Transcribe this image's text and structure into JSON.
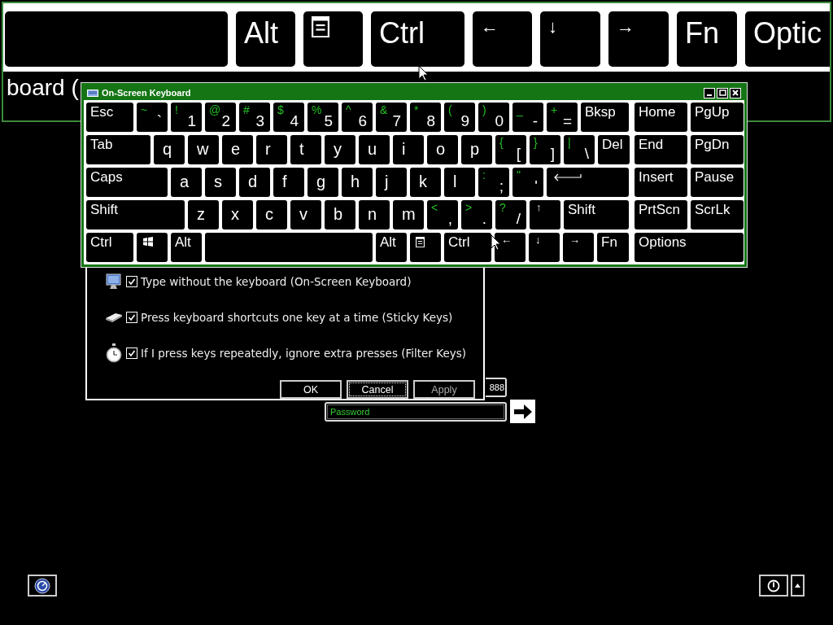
{
  "magnifier": {
    "keys": [
      {
        "kind": "space"
      },
      {
        "kind": "text",
        "label": "Alt"
      },
      {
        "kind": "menu"
      },
      {
        "kind": "text",
        "label": "Ctrl"
      },
      {
        "kind": "arrow",
        "label": "←"
      },
      {
        "kind": "arrow",
        "label": "↓"
      },
      {
        "kind": "arrow",
        "label": "→"
      },
      {
        "kind": "text",
        "label": "Fn"
      },
      {
        "kind": "text",
        "label": "Optic"
      }
    ],
    "text": "board ("
  },
  "keyboard": {
    "title": "On-Screen Keyboard",
    "rows": [
      {
        "keys": [
          {
            "kind": "text",
            "label": "Esc"
          },
          {
            "kind": "dual",
            "shift": "~",
            "label": "`"
          },
          {
            "kind": "dual",
            "shift": "!",
            "label": "1"
          },
          {
            "kind": "dual",
            "shift": "@",
            "label": "2"
          },
          {
            "kind": "dual",
            "shift": "#",
            "label": "3"
          },
          {
            "kind": "dual",
            "shift": "$",
            "label": "4"
          },
          {
            "kind": "dual",
            "shift": "%",
            "label": "5"
          },
          {
            "kind": "dual",
            "shift": "^",
            "label": "6"
          },
          {
            "kind": "dual",
            "shift": "&",
            "label": "7"
          },
          {
            "kind": "dual",
            "shift": "*",
            "label": "8"
          },
          {
            "kind": "dual",
            "shift": "(",
            "label": "9"
          },
          {
            "kind": "dual",
            "shift": ")",
            "label": "0"
          },
          {
            "kind": "dual",
            "shift": "_",
            "label": "-"
          },
          {
            "kind": "dual",
            "shift": "+",
            "label": "="
          },
          {
            "kind": "text",
            "label": "Bksp"
          }
        ]
      },
      {
        "keys": [
          {
            "kind": "text",
            "label": "Tab"
          },
          {
            "kind": "letter",
            "label": "q"
          },
          {
            "kind": "letter",
            "label": "w"
          },
          {
            "kind": "letter",
            "label": "e"
          },
          {
            "kind": "letter",
            "label": "r"
          },
          {
            "kind": "letter",
            "label": "t"
          },
          {
            "kind": "letter",
            "label": "y"
          },
          {
            "kind": "letter",
            "label": "u"
          },
          {
            "kind": "letter",
            "label": "i"
          },
          {
            "kind": "letter",
            "label": "o"
          },
          {
            "kind": "letter",
            "label": "p"
          },
          {
            "kind": "dual",
            "shift": "{",
            "label": "["
          },
          {
            "kind": "dual",
            "shift": "}",
            "label": "]"
          },
          {
            "kind": "dual",
            "shift": "|",
            "label": "\\"
          },
          {
            "kind": "text",
            "label": "Del"
          }
        ]
      },
      {
        "keys": [
          {
            "kind": "text",
            "label": "Caps"
          },
          {
            "kind": "letter",
            "label": "a"
          },
          {
            "kind": "letter",
            "label": "s"
          },
          {
            "kind": "letter",
            "label": "d"
          },
          {
            "kind": "letter",
            "label": "f"
          },
          {
            "kind": "letter",
            "label": "g"
          },
          {
            "kind": "letter",
            "label": "h"
          },
          {
            "kind": "letter",
            "label": "j"
          },
          {
            "kind": "letter",
            "label": "k"
          },
          {
            "kind": "letter",
            "label": "l"
          },
          {
            "kind": "dual",
            "shift": ":",
            "label": ";"
          },
          {
            "kind": "dual",
            "shift": "\"",
            "label": "'"
          },
          {
            "kind": "enter"
          }
        ]
      },
      {
        "keys": [
          {
            "kind": "text",
            "label": "Shift"
          },
          {
            "kind": "letter",
            "label": "z"
          },
          {
            "kind": "letter",
            "label": "x"
          },
          {
            "kind": "letter",
            "label": "c"
          },
          {
            "kind": "letter",
            "label": "v"
          },
          {
            "kind": "letter",
            "label": "b"
          },
          {
            "kind": "letter",
            "label": "n"
          },
          {
            "kind": "letter",
            "label": "m"
          },
          {
            "kind": "dual",
            "shift": "<",
            "label": ","
          },
          {
            "kind": "dual",
            "shift": ">",
            "label": "."
          },
          {
            "kind": "dual",
            "shift": "?",
            "label": "/"
          },
          {
            "kind": "arrow",
            "label": "↑"
          },
          {
            "kind": "text",
            "label": "Shift"
          }
        ]
      },
      {
        "keys": [
          {
            "kind": "text",
            "label": "Ctrl"
          },
          {
            "kind": "windows"
          },
          {
            "kind": "text",
            "label": "Alt"
          },
          {
            "kind": "space"
          },
          {
            "kind": "text",
            "label": "Alt"
          },
          {
            "kind": "menu"
          },
          {
            "kind": "text",
            "label": "Ctrl"
          },
          {
            "kind": "arrow",
            "label": "←"
          },
          {
            "kind": "arrow",
            "label": "↓"
          },
          {
            "kind": "arrow",
            "label": "→"
          },
          {
            "kind": "text",
            "label": "Fn"
          }
        ]
      }
    ],
    "nav_rows": [
      {
        "keys": [
          {
            "kind": "text",
            "label": "Home"
          },
          {
            "kind": "text",
            "label": "PgUp"
          }
        ]
      },
      {
        "keys": [
          {
            "kind": "text",
            "label": "End"
          },
          {
            "kind": "text",
            "label": "PgDn"
          }
        ]
      },
      {
        "keys": [
          {
            "kind": "text",
            "label": "Insert"
          },
          {
            "kind": "text",
            "label": "Pause"
          }
        ]
      },
      {
        "keys": [
          {
            "kind": "text",
            "label": "PrtScn"
          },
          {
            "kind": "text",
            "label": "ScrLk"
          }
        ]
      },
      {
        "keys": [
          {
            "kind": "text",
            "label": "Options"
          }
        ]
      }
    ]
  },
  "dialog": {
    "options": [
      {
        "label": "Type without the keyboard (On-Screen Keyboard)",
        "checked": true
      },
      {
        "label": "Press keyboard shortcuts one key at a time (Sticky Keys)",
        "checked": true
      },
      {
        "label": "If I press keys repeatedly, ignore extra presses (Filter Keys)",
        "checked": true
      }
    ],
    "buttons": [
      {
        "label": "OK",
        "focused": false,
        "disabled": false
      },
      {
        "label": "Cancel",
        "focused": true,
        "disabled": false
      },
      {
        "label": "Apply",
        "focused": false,
        "disabled": true
      }
    ]
  },
  "login": {
    "partial_text": "888",
    "password": {
      "placeholder": "Password"
    }
  }
}
